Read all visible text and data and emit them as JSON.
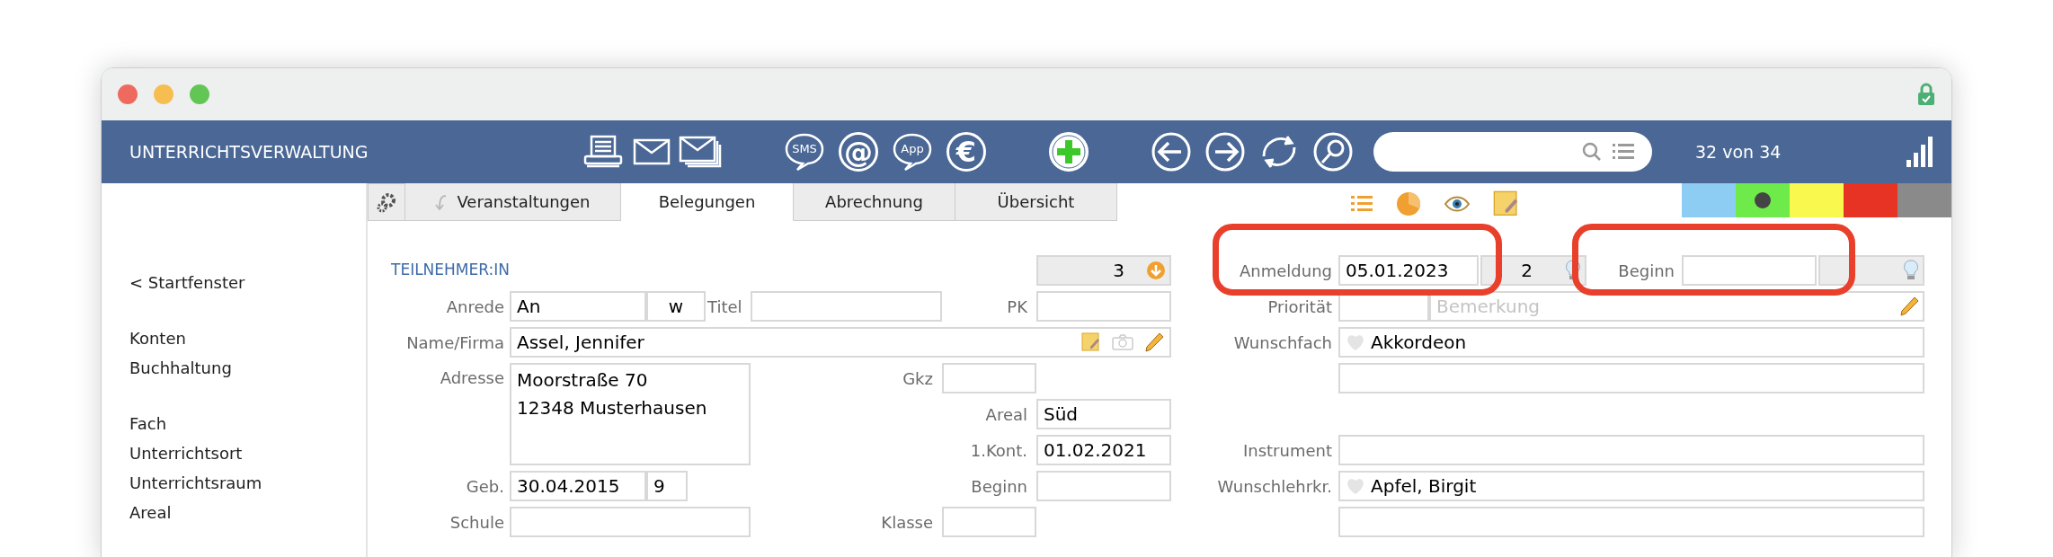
{
  "window": {
    "locked": true
  },
  "toolbar": {
    "title": "UNTERRICHTSVERWALTUNG",
    "buttons": [
      {
        "kind": "printer"
      },
      {
        "kind": "mail"
      },
      {
        "kind": "mails"
      },
      {
        "kind": "bubble",
        "label": "SMS"
      },
      {
        "kind": "glyph",
        "label": "@"
      },
      {
        "kind": "bubble",
        "label": "App"
      },
      {
        "kind": "glyph",
        "label": "€"
      },
      {
        "kind": "add"
      },
      {
        "kind": "back"
      },
      {
        "kind": "forward"
      },
      {
        "kind": "refresh"
      },
      {
        "kind": "find"
      }
    ],
    "record_counter": "32 von 34"
  },
  "sidebar": {
    "groups": [
      {
        "items": [
          {
            "label": "< Startfenster"
          }
        ]
      },
      {
        "items": [
          {
            "label": "Konten"
          },
          {
            "label": "Buchhaltung"
          }
        ]
      },
      {
        "items": [
          {
            "label": "Fach"
          },
          {
            "label": "Unterrichtsort"
          },
          {
            "label": "Unterrichtsraum"
          },
          {
            "label": "Areal"
          }
        ]
      }
    ]
  },
  "tabs": [
    {
      "label": "Veranstaltungen",
      "selected": false
    },
    {
      "label": "Belegungen",
      "selected": true
    },
    {
      "label": "Abrechnung",
      "selected": false
    },
    {
      "label": "Übersicht",
      "selected": false
    }
  ],
  "swatches": [
    {
      "color": "#8ecdf3",
      "selected": false
    },
    {
      "color": "#6eea4a",
      "selected": true
    },
    {
      "color": "#f8f84e",
      "selected": false
    },
    {
      "color": "#e63323",
      "selected": false
    },
    {
      "color": "#8a8a8a",
      "selected": false
    }
  ],
  "participant": {
    "heading": "TEILNEHMER:IN",
    "number": "3",
    "anrede": {
      "label": "Anrede",
      "value": "An"
    },
    "gender": "w",
    "titel": {
      "label": "Titel"
    },
    "pk": {
      "label": "PK"
    },
    "name": {
      "label": "Name/Firma",
      "value": "Assel, Jennifer"
    },
    "adresse": {
      "label": "Adresse",
      "lines": [
        "Moorstraße 70",
        "12348 Musterhausen"
      ]
    },
    "gkz": {
      "label": "Gkz"
    },
    "areal": {
      "label": "Areal",
      "value": "Süd"
    },
    "kontakt": {
      "label": "1.Kont.",
      "value": "01.02.2021"
    },
    "geb": {
      "label": "Geb.",
      "value": "30.04.2015"
    },
    "age": "9",
    "beginn": {
      "label": "Beginn"
    },
    "schule": {
      "label": "Schule"
    },
    "klasse": {
      "label": "Klasse"
    }
  },
  "registration": {
    "anmeldung": {
      "label": "Anmeldung",
      "value": "05.01.2023"
    },
    "number": "2",
    "beginn": {
      "label": "Beginn"
    },
    "prioritaet": {
      "label": "Priorität"
    },
    "bemerkung": {
      "placeholder": "Bemerkung"
    },
    "wunschfach": {
      "label": "Wunschfach",
      "value": "Akkordeon"
    },
    "instrument": {
      "label": "Instrument"
    },
    "wunschlehrkraft": {
      "label": "Wunschlehrkr.",
      "value": "Apfel, Birgit"
    }
  },
  "annotations": [
    {
      "kind": "frame"
    },
    {
      "kind": "frame"
    }
  ]
}
